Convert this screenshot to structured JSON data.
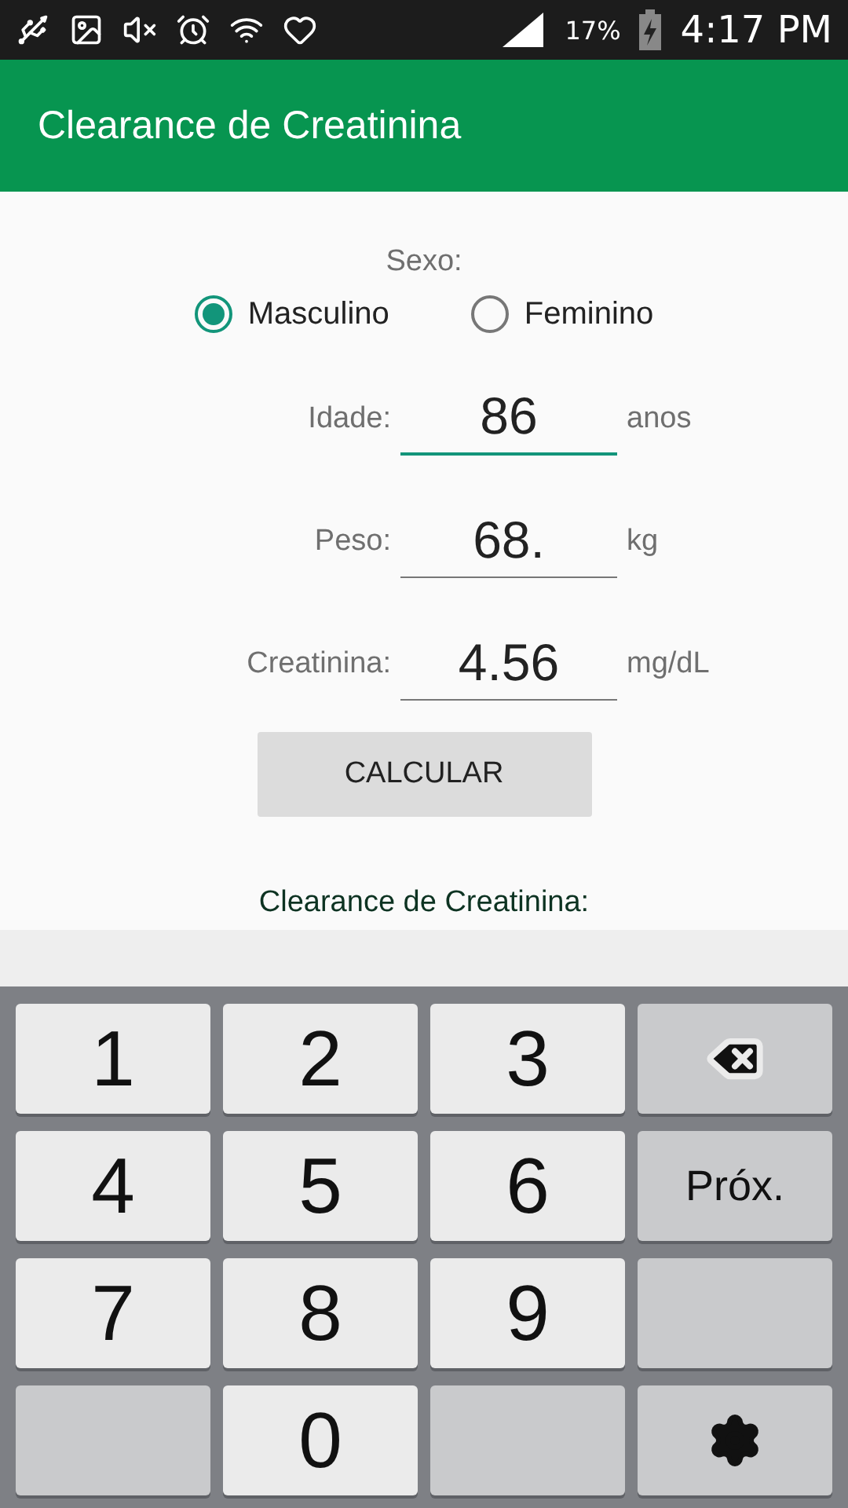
{
  "status_bar": {
    "battery": "17%",
    "time": "4:17 PM"
  },
  "app_bar": {
    "title": "Clearance de Creatinina"
  },
  "sex": {
    "label": "Sexo:",
    "options": [
      {
        "label": "Masculino",
        "selected": true
      },
      {
        "label": "Feminino",
        "selected": false
      }
    ]
  },
  "fields": [
    {
      "label": "Idade:",
      "value": "86",
      "unit": "anos",
      "focused": true
    },
    {
      "label": "Peso:",
      "value": "68.",
      "unit": "kg",
      "focused": false
    },
    {
      "label": "Creatinina:",
      "value": "4.56",
      "unit": "mg/dL",
      "focused": false
    }
  ],
  "button": "CALCULAR",
  "result_label": "Clearance de Creatinina:",
  "keyboard": [
    {
      "kind": "digit",
      "label": "1"
    },
    {
      "kind": "digit",
      "label": "2"
    },
    {
      "kind": "digit",
      "label": "3"
    },
    {
      "kind": "backspace"
    },
    {
      "kind": "digit",
      "label": "4"
    },
    {
      "kind": "digit",
      "label": "5"
    },
    {
      "kind": "digit",
      "label": "6"
    },
    {
      "kind": "action",
      "label": "Próx."
    },
    {
      "kind": "digit",
      "label": "7"
    },
    {
      "kind": "digit",
      "label": "8"
    },
    {
      "kind": "digit",
      "label": "9"
    },
    {
      "kind": "blank"
    },
    {
      "kind": "blank"
    },
    {
      "kind": "digit",
      "label": "0"
    },
    {
      "kind": "blank"
    },
    {
      "kind": "settings"
    }
  ]
}
